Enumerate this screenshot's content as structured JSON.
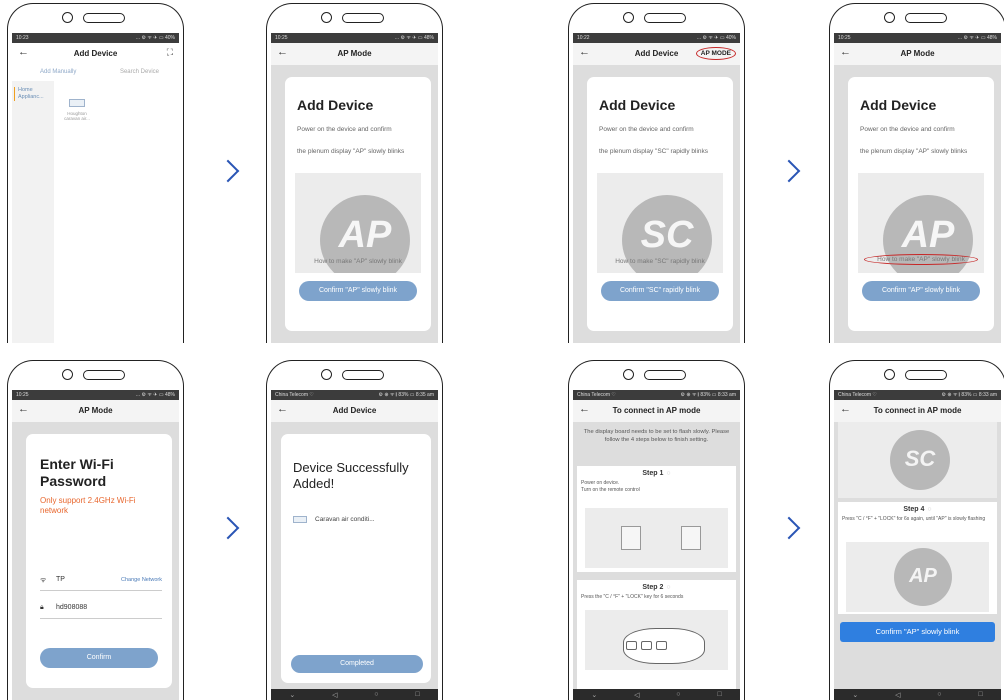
{
  "phone1": {
    "status_time": "10:23",
    "status_right": "... ⚙ ᯤ ✈ ▭ 40%",
    "title": "Add Device",
    "tab_manual": "Add Manually",
    "tab_search": "Search Device",
    "category": "Home Applianc...",
    "device_name": "Houghton caravan air..."
  },
  "phone2": {
    "status_time": "10:25",
    "status_right": "... ⚙ ᯤ ✈ ▭ 48%",
    "title": "AP Mode",
    "heading": "Add Device",
    "line1": "Power on the device and confirm",
    "line2": "the plenum display \"AP\" slowly blinks",
    "display_code": "AP",
    "howto": "How to make \"AP\" slowly blink",
    "button": "Confirm \"AP\" slowly blink"
  },
  "phone3": {
    "status_time": "10:22",
    "status_right": "... ⚙ ᯤ ✈ ▭ 40%",
    "title": "Add Device",
    "ap_mode_label": "AP MODE",
    "heading": "Add Device",
    "line1": "Power on the device and confirm",
    "line2": "the plenum display \"SC\" rapidly blinks",
    "display_code": "SC",
    "howto": "How to make \"SC\" rapidly blink",
    "button": "Confirm \"SC\" rapidly blink"
  },
  "phone4": {
    "status_time": "10:25",
    "status_right": "... ⚙ ᯤ ✈ ▭ 48%",
    "title": "AP Mode",
    "heading": "Add Device",
    "line1": "Power on the device and confirm",
    "line2": "the plenum display \"AP\" slowly blinks",
    "display_code": "AP",
    "howto": "How to make \"AP\" slowly blink",
    "button": "Confirm \"AP\" slowly blink"
  },
  "phone5": {
    "status_time": "10:25",
    "status_right": "... ⚙ ᯤ ✈ ▭ 48%",
    "title": "AP Mode",
    "heading": "Enter Wi-Fi Password",
    "warning": "Only support 2.4GHz Wi-Fi network",
    "ssid": "TP",
    "change_network": "Change Network",
    "password": "hd908088",
    "button": "Confirm"
  },
  "phone6": {
    "status_left": "China Telecom ♡",
    "status_right": "⚙ ⊕ ᯤ 𝄃 83% ▭ 8:35 am",
    "title": "Add Device",
    "heading": "Device Successfully Added!",
    "device": "Caravan air conditi...",
    "button": "Completed",
    "nav": [
      "⌄",
      "◁",
      "○",
      "□"
    ]
  },
  "phone7": {
    "status_left": "China Telecom ♡",
    "status_right": "⚙ ⊕ ᯤ 𝄃 83% ▭ 8:33 am",
    "title": "To connect in AP mode",
    "intro": "The display board needs to be set to flash slowly. Please follow the 4 steps below to finish setting.",
    "step1_title": "Step 1",
    "step1_text1": "Power on device.",
    "step1_text2": "Turn on the remote control",
    "step2_title": "Step 2",
    "step2_text": "Press the \"C / °F\" + \"LOCK\" key for 6 seconds",
    "nav": [
      "⌄",
      "◁",
      "○",
      "□"
    ]
  },
  "phone8": {
    "status_left": "China Telecom ♡",
    "status_right": "⚙ ⊕ ᯤ 𝄃 83% ▭ 8:33 am",
    "title": "To connect in AP mode",
    "top_code": "SC",
    "step4_title": "Step 4",
    "step4_text": "Press \"C / °F\" + \"LOCK\" for 6s again, until \"AP\" is slowly flashing",
    "bottom_code": "AP",
    "button": "Confirm \"AP\" slowly blink",
    "nav": [
      "⌄",
      "◁",
      "○",
      "□"
    ]
  }
}
